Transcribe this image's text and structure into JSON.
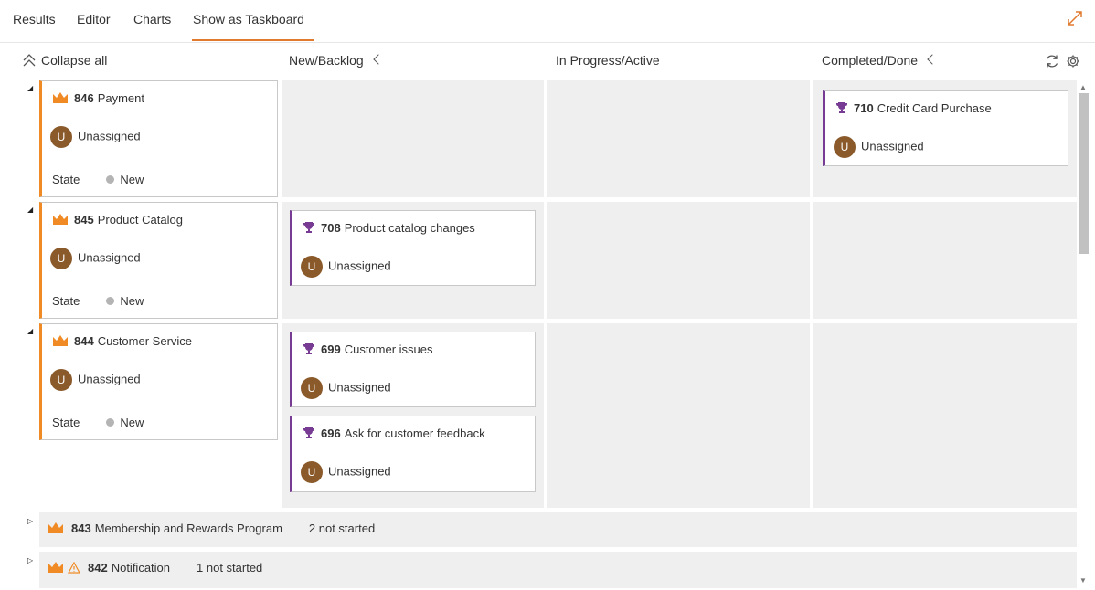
{
  "tabs": [
    {
      "label": "Results"
    },
    {
      "label": "Editor"
    },
    {
      "label": "Charts"
    },
    {
      "label": "Show as Taskboard"
    }
  ],
  "header": {
    "collapse_all": "Collapse all",
    "columns": [
      "New/Backlog",
      "In Progress/Active",
      "Completed/Done"
    ]
  },
  "rows": [
    {
      "parent": {
        "id": "846",
        "title": "Payment",
        "assignee": "Unassigned",
        "state_label": "State",
        "state": "New",
        "avatar": "U"
      },
      "completed": [
        {
          "id": "710",
          "title": "Credit Card Purchase",
          "assignee": "Unassigned",
          "avatar": "U"
        }
      ]
    },
    {
      "parent": {
        "id": "845",
        "title": "Product Catalog",
        "assignee": "Unassigned",
        "state_label": "State",
        "state": "New",
        "avatar": "U"
      },
      "new": [
        {
          "id": "708",
          "title": "Product catalog changes",
          "assignee": "Unassigned",
          "avatar": "U"
        }
      ]
    },
    {
      "parent": {
        "id": "844",
        "title": "Customer Service",
        "assignee": "Unassigned",
        "state_label": "State",
        "state": "New",
        "avatar": "U"
      },
      "new": [
        {
          "id": "699",
          "title": "Customer issues",
          "assignee": "Unassigned",
          "avatar": "U"
        },
        {
          "id": "696",
          "title": "Ask for customer feedback",
          "assignee": "Unassigned",
          "avatar": "U"
        }
      ]
    }
  ],
  "collapsed_lanes": [
    {
      "id": "843",
      "title": "Membership and Rewards Program",
      "summary": "2 not started"
    },
    {
      "id": "842",
      "title": "Notification",
      "summary": "1 not started"
    }
  ],
  "icons": {
    "epic": "crown-icon",
    "feature": "trophy-icon",
    "warning": "warning-icon",
    "refresh": "refresh-icon",
    "settings": "gear-icon",
    "expand": "expand-icon"
  },
  "colors": {
    "accent": "#e07a2f",
    "epic": "#f08a24",
    "feature": "#773b93",
    "avatar": "#8b5a2b"
  }
}
